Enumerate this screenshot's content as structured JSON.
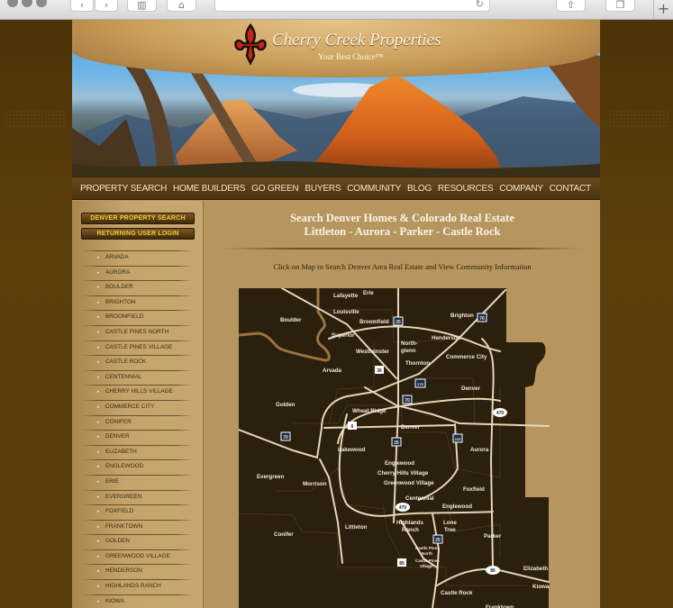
{
  "browser": {
    "back_icon": "‹",
    "forward_icon": "›",
    "sidebar_icon": "▥",
    "home_icon": "⌂",
    "reload_icon": "↻",
    "share_icon": "⇧",
    "tabs_icon": "❐",
    "new_tab_icon": "+"
  },
  "header": {
    "brand": "Cherry Creek Properties",
    "tagline": "Your Best Choice™"
  },
  "nav": {
    "items": [
      "PROPERTY SEARCH",
      "HOME BUILDERS",
      "GO GREEN",
      "BUYERS",
      "COMMUNITY",
      "BLOG",
      "RESOURCES",
      "COMPANY",
      "CONTACT"
    ]
  },
  "sidebar": {
    "search_button": "DENVER PROPERTY SEARCH",
    "login_button": "RETURNING USER LOGIN",
    "cities": [
      "ARVADA",
      "AURORA",
      "BOULDER",
      "BRIGHTON",
      "BROOMFIELD",
      "CASTLE PINES NORTH",
      "CASTLE PINES VILLAGE",
      "CASTLE ROCK",
      "CENTENNIAL",
      "CHERRY HILLS VILLAGE",
      "COMMERCE CITY",
      "CONIFER",
      "DENVER",
      "ELIZABETH",
      "ENGLEWOOD",
      "ERIE",
      "EVERGREEN",
      "FOXFIELD",
      "FRANKTOWN",
      "GOLDEN",
      "GREENWOOD VILLAGE",
      "HENDERSON",
      "HIGHLANDS RANCH",
      "KIOWA"
    ]
  },
  "main": {
    "title_line1": "Search Denver Homes & Colorado Real Estate",
    "title_line2": "Littleton - Aurora - Parker - Castle Rock",
    "instruction": "Click on Map to Search Denver Area Real Estate and View Community Information"
  },
  "map": {
    "labels": {
      "lafayette": "Lafayette",
      "erie": "Erie",
      "boulder": "Boulder",
      "louisville": "Louisville",
      "broomfield": "Broomfield",
      "brighton": "Brighton",
      "superior": "Superior",
      "henderson": "Henderson",
      "northglenn1": "North-",
      "northglenn2": "glenn",
      "westminster": "Westminster",
      "commerce_city": "Commerce City",
      "thornton": "Thornton",
      "arvada": "Arvada",
      "denver_north": "Denver",
      "golden": "Golden",
      "wheat_ridge": "Wheat Ridge",
      "denver": "Denver",
      "lakewood": "Lakewood",
      "aurora": "Aurora",
      "englewood": "Englewood",
      "evergreen": "Evergreen",
      "cherry_hills": "Cherry Hills Village",
      "morrison": "Morrison",
      "greenwood": "Greenwood Village",
      "foxfield": "Foxfield",
      "centennial": "Centennial",
      "englewood2": "Englewood",
      "highlands1": "Highlands",
      "highlands2": "Ranch",
      "lone1": "Lone",
      "lone2": "Tree",
      "conifer": "Conifer",
      "littleton": "Littleton",
      "parker": "Parker",
      "cpn1": "Castle Pines",
      "cpn2": "North",
      "cpv1": "Castle Pines",
      "cpv2": "Village",
      "elizabeth": "Elizabeth",
      "kiowa": "Kiowa",
      "castle_rock": "Castle Rock",
      "franktown": "Franktown"
    },
    "shields": {
      "i25": "25",
      "i76": "76",
      "us36": "36",
      "i270": "270",
      "i70": "70",
      "us6": "6",
      "i70w": "70",
      "i225": "225",
      "i25s": "25",
      "r470e": "470",
      "r470": "470",
      "i25c": "25",
      "us85": "85",
      "r86": "86"
    }
  },
  "colors": {
    "page_bg": "#5a3d0b",
    "site_bg": "#b9975f",
    "nav_bg": "#5a3d15",
    "button_text": "#f5c93c",
    "map_fill": "#2b1f0d",
    "road": "#e8dcc0"
  }
}
